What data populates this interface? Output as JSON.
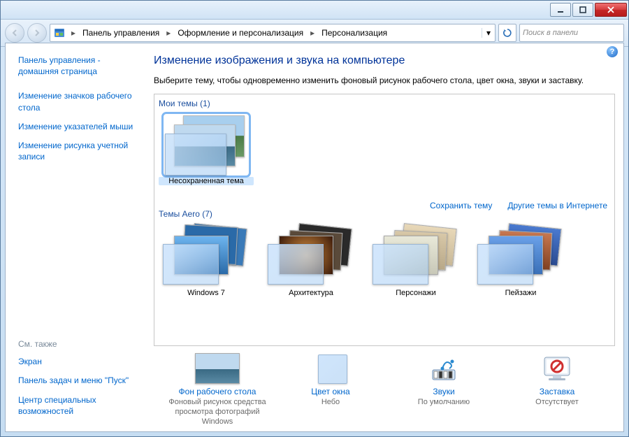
{
  "titlebar": {
    "title": ""
  },
  "breadcrumb": {
    "items": [
      "Панель управления",
      "Оформление и персонализация",
      "Персонализация"
    ]
  },
  "search": {
    "placeholder": "Поиск в панели"
  },
  "sidebar": {
    "home": "Панель управления - домашняя страница",
    "links": [
      "Изменение значков рабочего стола",
      "Изменение указателей мыши",
      "Изменение рисунка учетной записи"
    ],
    "see_also_hdr": "См. также",
    "see_also": [
      "Экран",
      "Панель задач и меню \"Пуск\"",
      "Центр специальных возможностей"
    ]
  },
  "main": {
    "heading": "Изменение изображения и звука на компьютере",
    "desc": "Выберите тему, чтобы одновременно изменить фоновый рисунок рабочего стола, цвет окна, звуки и заставку.",
    "my_themes_hdr": "Мои темы (1)",
    "my_themes": [
      {
        "label": "Несохраненная тема"
      }
    ],
    "save_link": "Сохранить тему",
    "online_link": "Другие темы в Интернете",
    "aero_hdr": "Темы Aero (7)",
    "aero": [
      {
        "label": "Windows 7"
      },
      {
        "label": "Архитектура"
      },
      {
        "label": "Персонажи"
      },
      {
        "label": "Пейзажи"
      }
    ],
    "bottom": [
      {
        "link": "Фон рабочего стола",
        "sub": "Фоновый рисунок средства просмотра фотографий Windows"
      },
      {
        "link": "Цвет окна",
        "sub": "Небо"
      },
      {
        "link": "Звуки",
        "sub": "По умолчанию"
      },
      {
        "link": "Заставка",
        "sub": "Отсутствует"
      }
    ]
  }
}
